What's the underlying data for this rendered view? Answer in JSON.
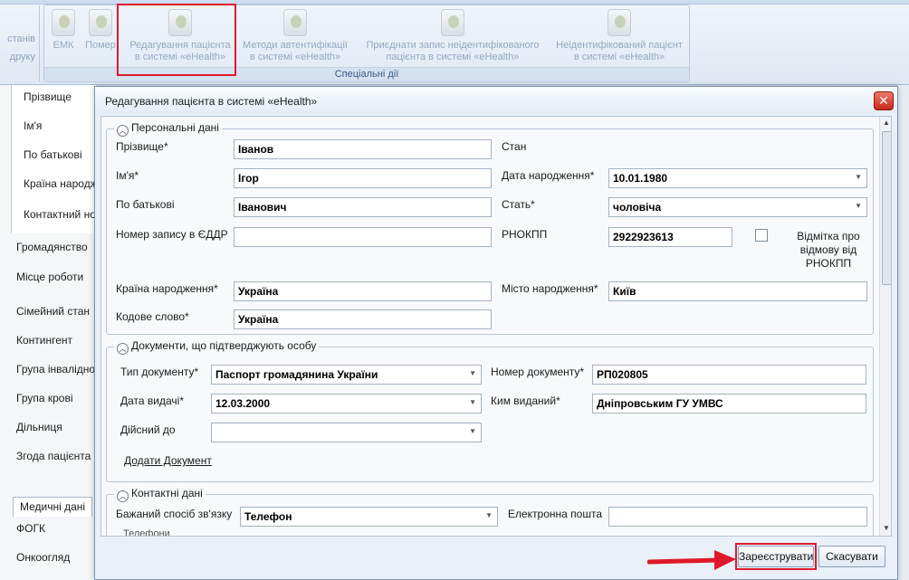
{
  "ribbon": {
    "left_labels": [
      "станів",
      "друку"
    ],
    "buttons": [
      {
        "label": "ЕМК",
        "name": "emk-button"
      },
      {
        "label": "Помер",
        "name": "pomer-button"
      },
      {
        "label": "Редагування пацієнта\nв системі «eHealth»",
        "name": "edit-patient-ehealth-button"
      },
      {
        "label": "Методи автентифікації\nв системі «eHealth»",
        "name": "auth-methods-ehealth-button"
      },
      {
        "label": "Приєднати запис неідентифікованого\nпацієнта в системі «eHealth»",
        "name": "attach-unidentified-record-button"
      },
      {
        "label": "Неідентифікований пацієнт\nв системі «eHealth»",
        "name": "unidentified-patient-button"
      }
    ],
    "group_label": "Спеціальні дії"
  },
  "side": {
    "items_inner": [
      "Прізвище",
      "Ім'я",
      "По батькові",
      "Країна народж",
      "Контактний но"
    ],
    "items_outer": [
      "Громадянство",
      "Місце роботи",
      "Сімейний стан",
      "Контингент",
      "Група інвалідно",
      "Група крові",
      "Дільниця",
      "Згода пацієнта"
    ],
    "tab": "Медичні дані",
    "bottom_items": [
      "ФОГК",
      "Онкоогляд"
    ]
  },
  "dialog": {
    "title": "Редагування пацієнта в системі «eHealth»",
    "close": "✕",
    "personal": {
      "legend": "Персональні дані",
      "surname_label": "Прізвище*",
      "surname": "Іванов",
      "name_label": "Ім'я*",
      "name": "Ігор",
      "patronymic_label": "По батькові",
      "patronymic": "Іванович",
      "eddr_label": "Номер запису в ЄДДР",
      "eddr": "",
      "birth_country_label": "Країна народження*",
      "birth_country": "Україна",
      "codeword_label": "Кодове слово*",
      "codeword": "Україна",
      "status_label": "Стан",
      "dob_label": "Дата народження*",
      "dob": "10.01.1980",
      "sex_label": "Стать*",
      "sex": "чоловіча",
      "rnokpp_label": "РНОКПП",
      "rnokpp": "2922923613",
      "refusal_label": "Відмітка про відмову від РНОКПП",
      "birth_city_label": "Місто народження*",
      "birth_city": "Київ"
    },
    "documents": {
      "legend": "Документи, що підтверджують особу",
      "type_label": "Тип документу*",
      "type": "Паспорт громадянина України",
      "number_label": "Номер документу*",
      "number": "РП020805",
      "issue_date_label": "Дата видачі*",
      "issue_date": "12.03.2000",
      "issued_by_label": "Ким виданий*",
      "issued_by": "Дніпровським ГУ УМВС",
      "valid_until_label": "Дійсний до",
      "valid_until": "",
      "add_link": "Додати Документ"
    },
    "contacts": {
      "legend": "Контактні дані",
      "method_label": "Бажаний спосіб зв'язку",
      "method": "Телефон",
      "email_label": "Електронна пошта",
      "email": "",
      "phones_legend": "Телефони"
    },
    "register_button": "Зареєструвати",
    "cancel_button": "Скасувати"
  },
  "colors": {
    "accent_red": "#e0192a",
    "close_red": "#c7281a"
  }
}
